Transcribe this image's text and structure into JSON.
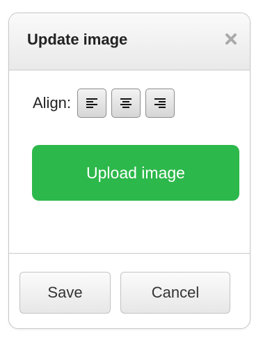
{
  "dialog": {
    "title": "Update image",
    "close_icon": "close-icon"
  },
  "align": {
    "label": "Align:",
    "options": [
      {
        "name": "align-left",
        "icon": "align-left-icon"
      },
      {
        "name": "align-center",
        "icon": "align-center-icon"
      },
      {
        "name": "align-right",
        "icon": "align-right-icon"
      }
    ]
  },
  "upload": {
    "label": "Upload image",
    "color": "#2db84b"
  },
  "footer": {
    "save_label": "Save",
    "cancel_label": "Cancel"
  }
}
